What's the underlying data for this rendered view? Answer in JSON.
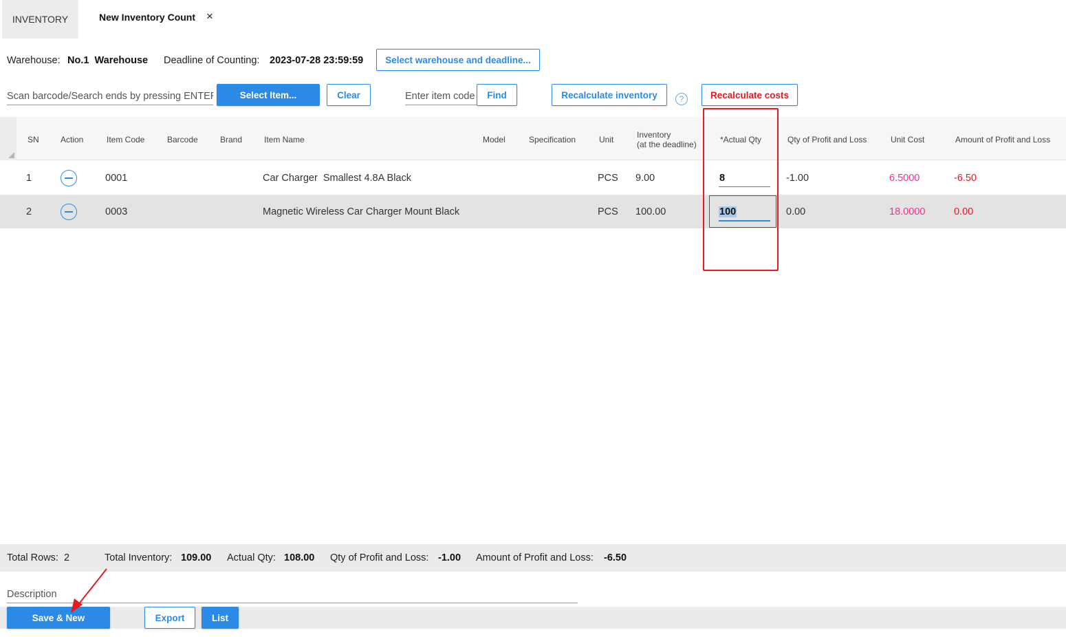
{
  "tabs": {
    "inventory": "INVENTORY",
    "current": "New Inventory Count",
    "close": "×"
  },
  "warehouse": {
    "warehouse_label": "Warehouse:",
    "warehouse_value": "No.1  Warehouse",
    "deadline_label": "Deadline of Counting:",
    "deadline_value": "2023-07-28 23:59:59",
    "select_button": "Select warehouse and deadline..."
  },
  "toolbar": {
    "scan_placeholder": "Scan barcode/Search ends by pressing ENTER",
    "select_item": "Select Item...",
    "clear": "Clear",
    "item_code_placeholder": "Enter item code",
    "find": "Find",
    "recalc_inventory": "Recalculate inventory",
    "help": "?",
    "recalc_costs": "Recalculate costs"
  },
  "table": {
    "headers": {
      "sn": "SN",
      "action": "Action",
      "item_code": "Item Code",
      "barcode": "Barcode",
      "brand": "Brand",
      "item_name": "Item Name",
      "model": "Model",
      "spec": "Specification",
      "unit": "Unit",
      "inventory_l1": "Inventory",
      "inventory_l2": "(at the deadline)",
      "actual_qty": "*Actual Qty",
      "qty_pl": "Qty of Profit and Loss",
      "unit_cost": "Unit Cost",
      "amount_pl": "Amount of Profit and Loss"
    },
    "rows": [
      {
        "sn": "1",
        "item_code": "0001",
        "item_name": "Car Charger  Smallest 4.8A Black",
        "unit": "PCS",
        "inventory": "9.00",
        "actual_qty": "8",
        "qty_pl": "-1.00",
        "unit_cost": "6.5000",
        "amount_pl": "-6.50"
      },
      {
        "sn": "2",
        "item_code": "0003",
        "item_name": "Magnetic Wireless Car Charger Mount Black",
        "unit": "PCS",
        "inventory": "100.00",
        "actual_qty": "100",
        "qty_pl": "0.00",
        "unit_cost": "18.0000",
        "amount_pl": "0.00"
      }
    ]
  },
  "summary": {
    "total_rows_label": "Total Rows:",
    "total_rows": "2",
    "total_inventory_label": "Total Inventory:",
    "total_inventory": "109.00",
    "actual_qty_label": "Actual Qty:",
    "actual_qty": "108.00",
    "qty_pl_label": "Qty of Profit and Loss:",
    "qty_pl": "-1.00",
    "amount_pl_label": "Amount of Profit and Loss:",
    "amount_pl": "-6.50"
  },
  "footer": {
    "description_placeholder": "Description",
    "save_new": "Save & New",
    "export": "Export",
    "list": "List"
  },
  "colors": {
    "accent": "#2b8ae6",
    "red": "#e8191c",
    "pink": "#e8339a"
  }
}
